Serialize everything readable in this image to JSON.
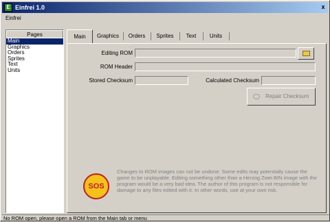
{
  "window": {
    "title": "Einfrei 1.0",
    "app_icon": "E",
    "close_label": "x"
  },
  "menu": {
    "items": [
      "Einfrei"
    ]
  },
  "pages": {
    "header": "Pages",
    "items": [
      "Main",
      "Graphics",
      "Orders",
      "Sprites",
      "Text",
      "Units"
    ],
    "selected": "Main"
  },
  "tabs": [
    "Main",
    "Graphics",
    "Orders",
    "Sprites",
    "Text",
    "Units"
  ],
  "main": {
    "editing_rom_label": "Editing ROM",
    "editing_rom_value": "",
    "rom_header_label": "ROM Header",
    "rom_header_value": "",
    "stored_checksum_label": "Stored Checksum",
    "stored_checksum_value": "",
    "calculated_checksum_label": "Calculated Checksum",
    "calculated_checksum_value": "",
    "repair_button": "Repair Checksum",
    "sos_logo": "SOS",
    "warning": "Changes to ROM images can not be undone. Some edits may potentially cause the game to be unplayable. Editing something other than a Herzog Zwei BIN image with the program would be a very bad idea. The author of this program is not responsible for damage to any files edited with it. In other words, use at your own risk."
  },
  "status": "No ROM open, please open a ROM from the Main tab or menu",
  "icons": {
    "folder": "folder-open-icon",
    "repair": "wrench-icon",
    "app": "app-icon"
  },
  "colors": {
    "titlebar_start": "#0a246a",
    "titlebar_end": "#a6caf0",
    "selection": "#0a246a",
    "sos_fill": "#f4c21a",
    "sos_ring": "#c02020"
  }
}
